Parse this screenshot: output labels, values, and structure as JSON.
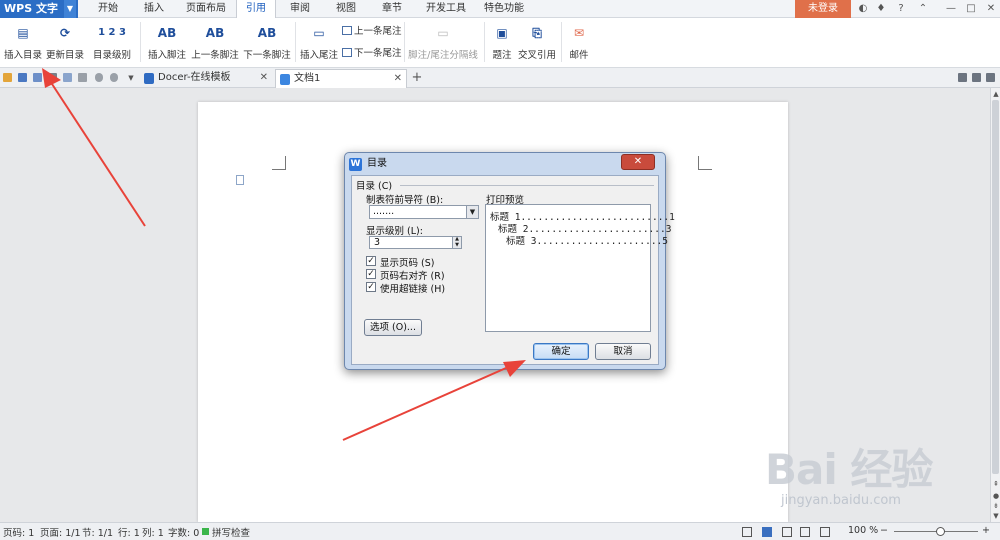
{
  "app": {
    "name": "WPS 文字"
  },
  "menu": {
    "tabs": [
      "开始",
      "插入",
      "页面布局",
      "引用",
      "审阅",
      "视图",
      "章节",
      "开发工具",
      "特色功能"
    ],
    "active": "引用",
    "login": "未登录",
    "right_icons": [
      "?",
      "—",
      "□"
    ]
  },
  "ribbon": {
    "insert_toc": "插入目录",
    "update_toc": "更新目录",
    "toc_level": "目录级别",
    "insert_footnote": "插入脚注",
    "prev_footnote": "上一条脚注",
    "next_footnote": "下一条脚注",
    "insert_endnote": "插入尾注",
    "prev_endnote": "上一条尾注",
    "next_endnote": "下一条尾注",
    "separator": "脚注/尾注分隔线",
    "caption": "题注",
    "cross_ref": "交叉引用",
    "mail": "邮件",
    "ab": "AB",
    "level_icon": "1 2 3"
  },
  "doc_tabs": [
    {
      "label": "Docer-在线模板",
      "active": false
    },
    {
      "label": "文档1",
      "active": true
    }
  ],
  "dialog": {
    "title": "目录",
    "close": "✕",
    "group_label": "目录 (C)",
    "leader_label": "制表符前导符 (B):",
    "leader_value": ".......",
    "levels_label": "显示级别 (L):",
    "levels_value": "3",
    "checkboxes": [
      {
        "label": "显示页码 (S)",
        "checked": true
      },
      {
        "label": "页码右对齐 (R)",
        "checked": true
      },
      {
        "label": "使用超链接 (H)",
        "checked": true
      }
    ],
    "options_button": "选项 (O)...",
    "preview_label": "打印预览",
    "preview_lines": [
      "标题 1..........................1",
      "标题 2........................3",
      "标题 3......................5"
    ],
    "ok": "确定",
    "cancel": "取消"
  },
  "status": {
    "page_no": "页码: 1",
    "pages": "页面: 1/1",
    "section": "节: 1/1",
    "row": "行: 1",
    "col": "列: 1",
    "words": "字数: 0",
    "spell": "拼写检查",
    "zoom": "100 %"
  },
  "watermark": {
    "brand": "Bai 经验",
    "url": "jingyan.baidu.com"
  },
  "colors": {
    "accent": "#2b6dc5",
    "login": "#e0704a",
    "arrow": "#e8433a"
  }
}
